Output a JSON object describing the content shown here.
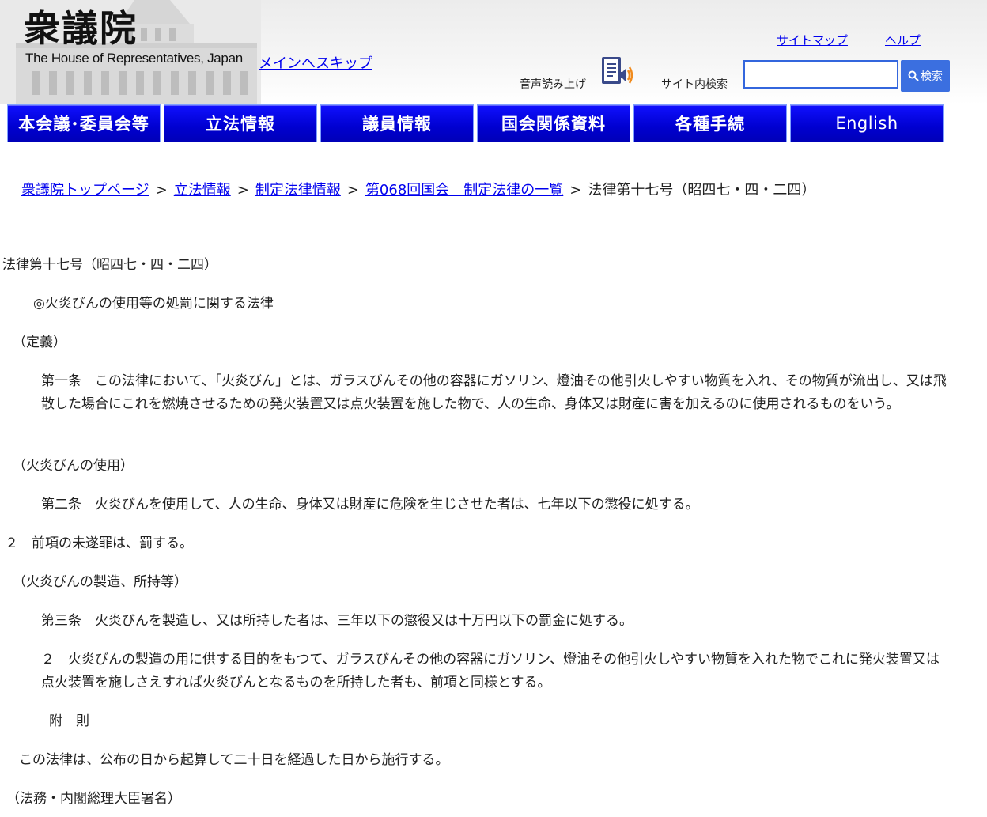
{
  "header": {
    "logo_main": "衆議院",
    "logo_sub": "The House of Representatives, Japan",
    "skip_link": "メインへスキップ",
    "sitemap": "サイトマップ",
    "help": "ヘルプ",
    "tts_label": "音声読み上げ",
    "search_label": "サイト内検索",
    "search_value": "",
    "search_button": "検索"
  },
  "nav": [
    "本会議･委員会等",
    "立法情報",
    "議員情報",
    "国会関係資料",
    "各種手続",
    "English"
  ],
  "breadcrumb": {
    "links": [
      "衆議院トップページ",
      "立法情報",
      "制定法律情報",
      "第068回国会　制定法律の一覧"
    ],
    "separator": ">",
    "current": "法律第十七号（昭四七・四・二四）"
  },
  "content": {
    "law_number": "法律第十七号（昭四七・四・二四）",
    "law_title": "◎火炎びんの使用等の処罰に関する法律",
    "h_definition": "（定義）",
    "art1": "第一条　この法律において、「火炎びん」とは、ガラスびんその他の容器にガソリン、燈油その他引火しやすい物質を入れ、その物質が流出し、又は飛散した場合にこれを燃焼させるための発火装置又は点火装置を施した物で、人の生命、身体又は財産に害を加えるのに使用されるものをいう。",
    "h_use": "（火炎びんの使用）",
    "art2": "第二条　火炎びんを使用して、人の生命、身体又は財産に危険を生じさせた者は、七年以下の懲役に処する。",
    "art2_p2": "２　前項の未遂罪は、罰する。",
    "h_manufacture": "（火炎びんの製造、所持等）",
    "art3": "第三条　火炎びんを製造し、又は所持した者は、三年以下の懲役又は十万円以下の罰金に処する。",
    "art3_p2": "２　火炎びんの製造の用に供する目的をもつて、ガラスびんその他の容器にガソリン、燈油その他引火しやすい物質を入れた物でこれに発火装置又は点火装置を施しさえすれば火炎びんとなるものを所持した者も、前項と同様とする。",
    "supplementary_heading": "附　則",
    "supplementary": "この法律は、公布の日から起算して二十日を経過した日から施行する。",
    "signatures": "（法務・内閣総理大臣署名）"
  },
  "colors": {
    "nav_blue": "#0000d0",
    "link_blue": "#0000ee",
    "search_button": "#3b6fe0"
  }
}
